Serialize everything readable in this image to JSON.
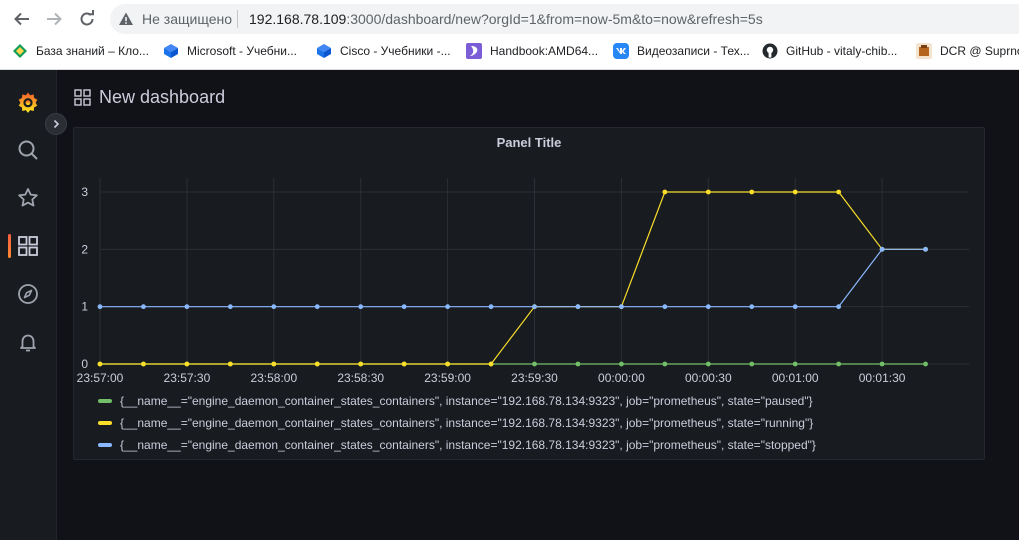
{
  "browser": {
    "not_secure_label": "Не защищено",
    "url_host": "192.168.78.109",
    "url_rest": ":3000/dashboard/new?orgId=1&from=now-5m&to=now&refresh=5s",
    "bookmarks": [
      {
        "label": "База знаний – Кло...",
        "icon": "green-diamond-icon",
        "color": "#0f9d58"
      },
      {
        "label": "Microsoft - Учебни...",
        "icon": "cisco-cube-icon",
        "color": "#1a73e8"
      },
      {
        "label": "Cisco - Учебники -...",
        "icon": "cisco-cube-icon",
        "color": "#1a73e8"
      },
      {
        "label": "Handbook:AMD64...",
        "icon": "gentoo-icon",
        "color": "#7b5dd6"
      },
      {
        "label": "Видеозаписи - Тех...",
        "icon": "vk-icon",
        "color": "#2787f5"
      },
      {
        "label": "GitHub - vitaly-chib...",
        "icon": "github-icon",
        "color": "#24292e"
      },
      {
        "label": "DCR @ Suprno",
        "icon": "dcr-icon",
        "color": "#b5651d"
      }
    ]
  },
  "grafana": {
    "page_title": "New dashboard",
    "panel_title": "Panel Title",
    "accent": "#f55f3e"
  },
  "chart_data": {
    "type": "line",
    "title": "Panel Title",
    "x_tick_labels": [
      "23:57:00",
      "23:57:30",
      "23:58:00",
      "23:58:30",
      "23:59:00",
      "23:59:30",
      "00:00:00",
      "00:00:30",
      "00:01:00",
      "00:01:30"
    ],
    "y_tick_labels": [
      "0",
      "1",
      "2",
      "3"
    ],
    "ylim": [
      0,
      3
    ],
    "x": [
      "23:57:00",
      "23:57:15",
      "23:57:30",
      "23:57:45",
      "23:58:00",
      "23:58:15",
      "23:58:30",
      "23:58:45",
      "23:59:00",
      "23:59:15",
      "23:59:30",
      "23:59:45",
      "00:00:00",
      "00:00:15",
      "00:00:30",
      "00:00:45",
      "00:01:00",
      "00:01:15",
      "00:01:30",
      "00:01:45"
    ],
    "grid": true,
    "legend_position": "bottom",
    "series": [
      {
        "name": "{__name__=\"engine_daemon_container_states_containers\", instance=\"192.168.78.134:9323\", job=\"prometheus\", state=\"paused\"}",
        "color": "#73bf69",
        "values": [
          0,
          0,
          0,
          0,
          0,
          0,
          0,
          0,
          0,
          0,
          0,
          0,
          0,
          0,
          0,
          0,
          0,
          0,
          0,
          0
        ]
      },
      {
        "name": "{__name__=\"engine_daemon_container_states_containers\", instance=\"192.168.78.134:9323\", job=\"prometheus\", state=\"running\"}",
        "color": "#fade2a",
        "values": [
          0,
          0,
          0,
          0,
          0,
          0,
          0,
          0,
          0,
          0,
          1,
          1,
          1,
          3,
          3,
          3,
          3,
          3,
          2,
          2
        ]
      },
      {
        "name": "{__name__=\"engine_daemon_container_states_containers\", instance=\"192.168.78.134:9323\", job=\"prometheus\", state=\"stopped\"}",
        "color": "#8ab8ff",
        "values": [
          1,
          1,
          1,
          1,
          1,
          1,
          1,
          1,
          1,
          1,
          1,
          1,
          1,
          1,
          1,
          1,
          1,
          1,
          2,
          2
        ]
      }
    ]
  }
}
